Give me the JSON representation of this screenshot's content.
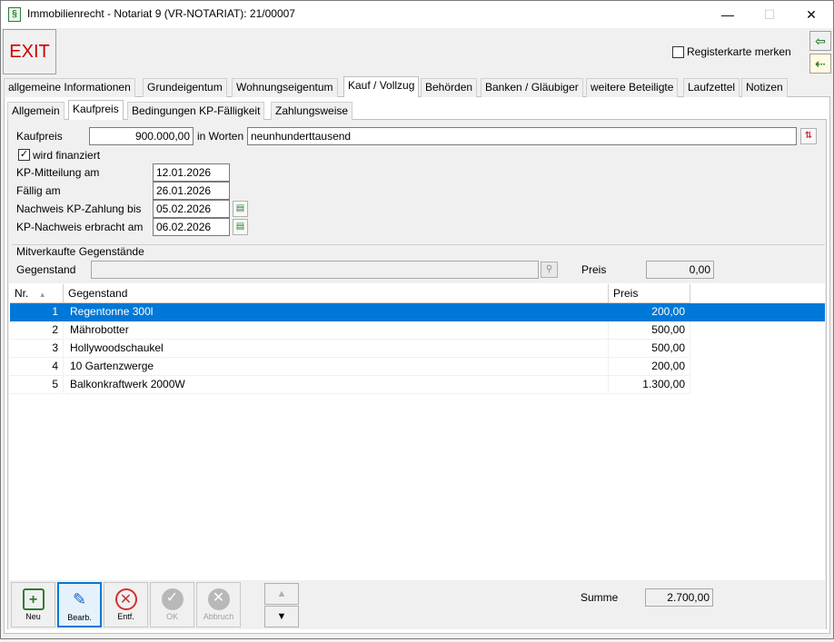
{
  "window": {
    "title": "Immobilienrecht - Notariat 9 (VR-NOTARIAT): 21/00007",
    "icon": "paragraph-icon",
    "minimize": "—",
    "maximize": "☐",
    "close": "✕"
  },
  "toolbar": {
    "exit_label": "EXIT",
    "remember_tab_label": "Registerkarte merken",
    "remember_tab_checked": false
  },
  "tabs": [
    {
      "label": "allgemeine Informationen",
      "active": false
    },
    {
      "label": "Grundeigentum",
      "active": false
    },
    {
      "label": "Wohnungseigentum",
      "active": false
    },
    {
      "label": "Kauf / Vollzug",
      "active": true
    },
    {
      "label": "Behörden",
      "active": false
    },
    {
      "label": "Banken / Gläubiger",
      "active": false
    },
    {
      "label": "weitere Beteiligte",
      "active": false
    },
    {
      "label": "Laufzettel",
      "active": false
    },
    {
      "label": "Notizen",
      "active": false
    }
  ],
  "subtabs": [
    {
      "label": "Allgemein",
      "active": false
    },
    {
      "label": "Kaufpreis",
      "active": true
    },
    {
      "label": "Bedingungen KP-Fälligkeit",
      "active": false
    },
    {
      "label": "Zahlungsweise",
      "active": false
    }
  ],
  "form": {
    "kaufpreis_label": "Kaufpreis",
    "kaufpreis_value": "900.000,00",
    "in_worten_label": "in Worten",
    "in_worten_value": "neunhunderttausend",
    "finanziert_label": "wird finanziert",
    "finanziert_checked": true,
    "mitteilung_label": "KP-Mitteilung am",
    "mitteilung_value": "12.01.2026",
    "faellig_label": "Fällig am",
    "faellig_value": "26.01.2026",
    "nachweis_zahlung_label": "Nachweis KP-Zahlung bis",
    "nachweis_zahlung_value": "05.02.2026",
    "nachweis_erbracht_label": "KP-Nachweis erbracht am",
    "nachweis_erbracht_value": "06.02.2026"
  },
  "mitverkauft": {
    "group_label": "Mitverkaufte Gegenstände",
    "gegenstand_label": "Gegenstand",
    "gegenstand_value": "",
    "preis_label": "Preis",
    "preis_value": "0,00"
  },
  "table": {
    "columns": [
      "Nr.",
      "Gegenstand",
      "Preis"
    ],
    "sort_indicator": "▲",
    "rows": [
      {
        "nr": "1",
        "gegenstand": "Regentonne 300l",
        "preis": "200,00",
        "selected": true
      },
      {
        "nr": "2",
        "gegenstand": "Mährobotter",
        "preis": "500,00",
        "selected": false
      },
      {
        "nr": "3",
        "gegenstand": "Hollywoodschaukel",
        "preis": "500,00",
        "selected": false
      },
      {
        "nr": "4",
        "gegenstand": "10 Gartenzwerge",
        "preis": "200,00",
        "selected": false
      },
      {
        "nr": "5",
        "gegenstand": "Balkonkraftwerk 2000W",
        "preis": "1.300,00",
        "selected": false
      }
    ]
  },
  "bottom": {
    "neu_label": "Neu",
    "bearb_label": "Bearb.",
    "entf_label": "Entf.",
    "ok_label": "OK",
    "abbruch_label": "Abbruch",
    "summe_label": "Summe",
    "summe_value": "2.700,00"
  },
  "colors": {
    "selection": "#0078d7",
    "exit_text": "#cc0000",
    "green_icon": "#2e7d32",
    "red_icon": "#d32f2f"
  }
}
